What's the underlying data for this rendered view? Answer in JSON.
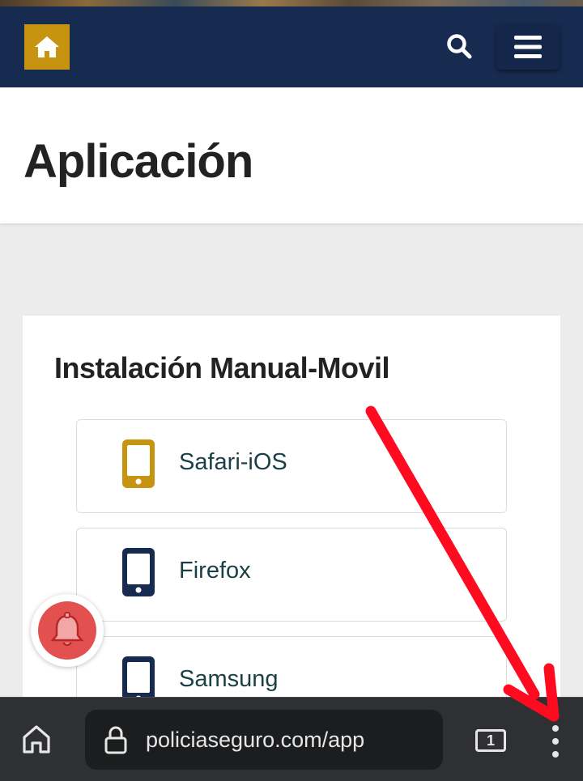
{
  "header": {
    "home_icon": "home-icon",
    "search_icon": "search-icon",
    "menu_icon": "hamburger-menu-icon",
    "brand_color": "#172a4f",
    "logo_color": "#c79412"
  },
  "page": {
    "title": "Aplicación"
  },
  "card": {
    "title": "Instalación Manual-Movil",
    "options": [
      {
        "label": "Safari-iOS",
        "icon": "smartphone-icon",
        "icon_color": "#c79412"
      },
      {
        "label": "Firefox",
        "icon": "smartphone-icon",
        "icon_color": "#172a4f"
      },
      {
        "label": "Samsung",
        "icon": "smartphone-icon",
        "icon_color": "#172a4f"
      }
    ]
  },
  "notification": {
    "icon": "bell-icon",
    "color": "#e35050"
  },
  "browser": {
    "url": "policiaseguro.com/app",
    "tab_count": "1",
    "home_icon": "home-icon",
    "lock_icon": "lock-icon",
    "more_icon": "more-vertical-icon"
  },
  "annotation": {
    "arrow_color": "#ff0a1f"
  }
}
